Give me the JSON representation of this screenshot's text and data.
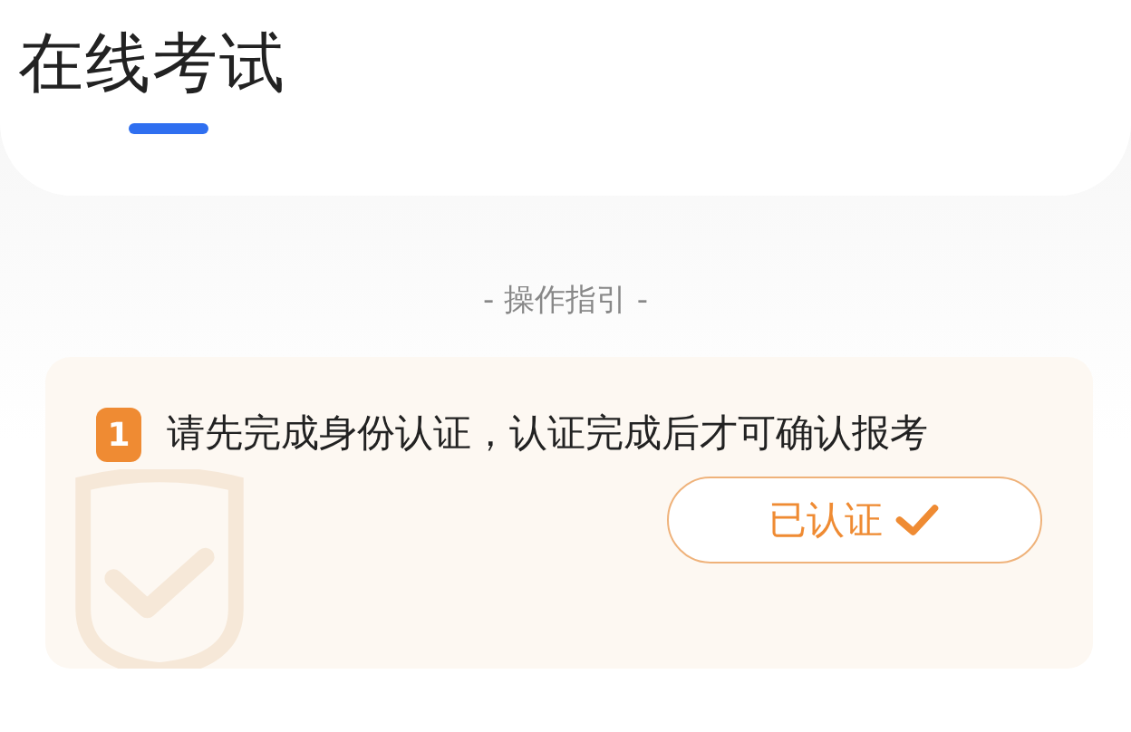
{
  "header": {
    "title": "在线考试"
  },
  "guide": {
    "heading": "- 操作指引 -",
    "steps": [
      {
        "number": "1",
        "text": "请先完成身份认证，认证完成后才可确认报考",
        "button": {
          "label": "已认证",
          "verified": true
        }
      }
    ]
  }
}
